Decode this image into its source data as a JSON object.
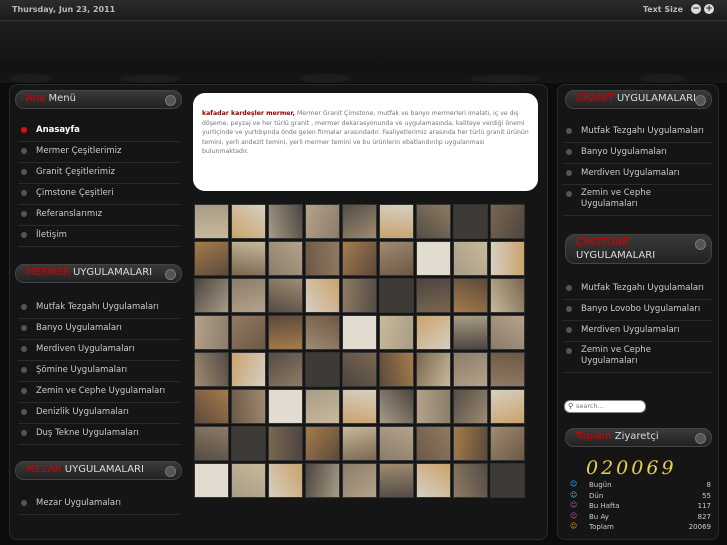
{
  "topbar": {
    "date": "Thursday, Jun 23, 2011",
    "text_size_label": "Text Size",
    "decrease": "−",
    "increase": "+"
  },
  "left": {
    "menu_title": {
      "a": "Ana",
      "b": "Menü"
    },
    "menu": [
      "Anasayfa",
      "Mermer Çeşitlerimiz",
      "Granit Çeşitlerimiz",
      "Çimstone Çeşitleri",
      "Referanslarımız",
      "İletişim"
    ],
    "mermer_title": {
      "a": "MERMER",
      "b": "UYGULAMALARI"
    },
    "mermer": [
      "Mutfak Tezgahı Uygulamaları",
      "Banyo Uygulamaları",
      "Merdiven Uygulamaları",
      "Şömine Uygulamaları",
      "Zemin ve Cephe Uygulamaları",
      "Denizlik Uygulamaları",
      "Duş Tekne Uygulamaları"
    ],
    "mezar_title": {
      "a": "MEZAR",
      "b": "UYGULAMALARI"
    },
    "mezar": [
      "Mezar Uygulamaları"
    ]
  },
  "center": {
    "brand": "kafadar kardeşler mermer,",
    "text": "Mermer Granit Çimstone, mutfak ve banyo mermerleri imalatı, iç ve dış döşeme, peyzaj ve her türlü granit , mermer dekarasyonunda ve uygulamasında, kaliteye verdiği önemi yurtiçinde ve yurtdışında önde gelen firmalar arasındadır. Faaliyetlerimiz arasında her türlü granit ürünün temini, yerli andezit temini, yerli mermer temini ve bu ürünlerin ebatlandırılıp uygulanması bulunmaktadır."
  },
  "right": {
    "granit_title": {
      "a": "GRANİT",
      "b": "UYGULAMALARI"
    },
    "granit": [
      "Mutfak Tezgahı Uygulamaları",
      "Banyo Uygulamaları",
      "Merdiven Uygulamaları",
      "Zemin ve Cephe Uygulamaları"
    ],
    "cimstone_title": {
      "a": "ÇİMSTONE",
      "b": "UYGULAMALARI"
    },
    "cimstone": [
      "Mutfak Tezgahı Uygulamaları",
      "Banyo Lovobo Uygulamaları",
      "Merdiven Uygulamaları",
      "Zemin ve Cephe Uygulamaları"
    ],
    "search_placeholder": "search...",
    "visitors_title": {
      "a": "Toplam",
      "b": "Ziyaretçi"
    },
    "counter": "020069",
    "stats": [
      {
        "label": "Bugün",
        "value": "8"
      },
      {
        "label": "Dün",
        "value": "55"
      },
      {
        "label": "Bu Hafta",
        "value": "117"
      },
      {
        "label": "Bu Ay",
        "value": "827"
      },
      {
        "label": "Toplam",
        "value": "20069"
      }
    ]
  },
  "colors": {
    "accent": "#d40000",
    "counter": "#e8d14a",
    "brand": "#8a0000"
  }
}
